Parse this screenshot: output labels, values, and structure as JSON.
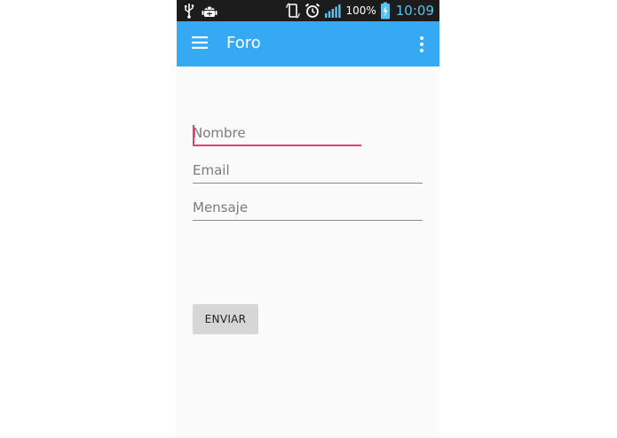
{
  "status_bar": {
    "battery_percent": "100%",
    "time": "10:09",
    "icons": [
      "usb-icon",
      "debug-android-icon",
      "rotate-icon",
      "alarm-icon",
      "signal-icon",
      "battery-charging-icon"
    ]
  },
  "app_bar": {
    "title": "Foro",
    "menu_icon": "hamburger-menu-icon",
    "overflow_icon": "more-vert-icon",
    "color": "#35a9f4"
  },
  "form": {
    "name_placeholder": "Nombre",
    "email_placeholder": "Email",
    "message_placeholder": "Mensaje",
    "focused_field": "name",
    "accent_color": "#e53e6f"
  },
  "send_button": {
    "label": "ENVIAR"
  }
}
